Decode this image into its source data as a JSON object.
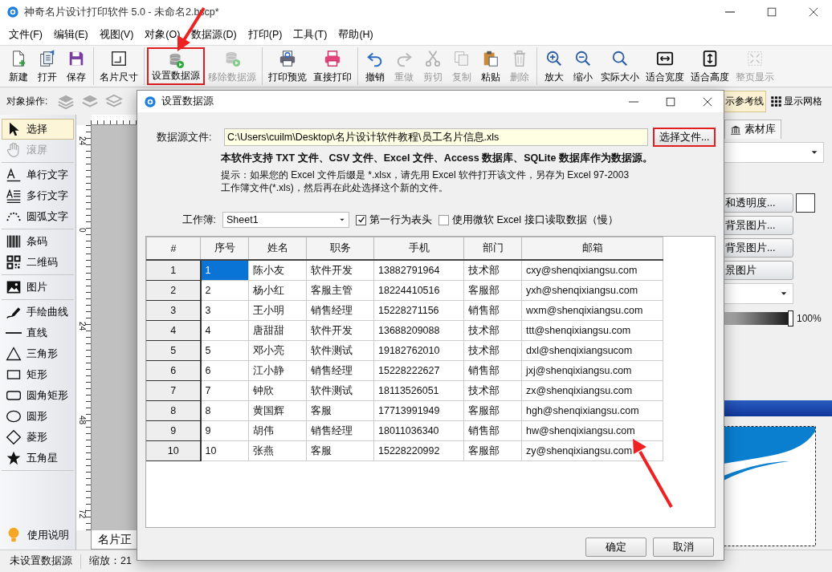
{
  "window": {
    "title": "神奇名片设计打印软件 5.0 - 未命名2.bscp*"
  },
  "menu": [
    "文件(F)",
    "编辑(E)",
    "视图(V)",
    "对象(O)",
    "数据源(D)",
    "打印(P)",
    "工具(T)",
    "帮助(H)"
  ],
  "toolbar": [
    {
      "items": [
        {
          "label": "新建",
          "disabled": false,
          "highlighted": false
        },
        {
          "label": "打开",
          "disabled": false,
          "highlighted": false
        },
        {
          "label": "保存",
          "disabled": false,
          "highlighted": false
        }
      ]
    },
    {
      "items": [
        {
          "label": "名片尺寸",
          "disabled": false,
          "highlighted": false
        }
      ]
    },
    {
      "items": [
        {
          "label": "设置数据源",
          "disabled": false,
          "highlighted": true
        },
        {
          "label": "移除数据源",
          "disabled": true,
          "highlighted": false
        }
      ]
    },
    {
      "items": [
        {
          "label": "打印预览",
          "disabled": false,
          "highlighted": false
        },
        {
          "label": "直接打印",
          "disabled": false,
          "highlighted": false
        }
      ]
    },
    {
      "items": [
        {
          "label": "撤销",
          "disabled": false,
          "highlighted": false
        },
        {
          "label": "重做",
          "disabled": true,
          "highlighted": false
        },
        {
          "label": "剪切",
          "disabled": true,
          "highlighted": false
        },
        {
          "label": "复制",
          "disabled": true,
          "highlighted": false
        },
        {
          "label": "粘贴",
          "disabled": false,
          "highlighted": false
        },
        {
          "label": "删除",
          "disabled": true,
          "highlighted": false
        }
      ]
    },
    {
      "items": [
        {
          "label": "放大",
          "disabled": false,
          "highlighted": false
        },
        {
          "label": "缩小",
          "disabled": false,
          "highlighted": false
        },
        {
          "label": "实际大小",
          "disabled": false,
          "highlighted": false
        },
        {
          "label": "适合宽度",
          "disabled": false,
          "highlighted": false
        },
        {
          "label": "适合高度",
          "disabled": false,
          "highlighted": false
        },
        {
          "label": "整页显示",
          "disabled": true,
          "highlighted": false
        }
      ]
    }
  ],
  "object_bar": {
    "label": "对象操作:",
    "guides": {
      "label": "示参考线",
      "selected": true
    },
    "grid": {
      "label": "显示网格",
      "selected": false
    }
  },
  "tools": [
    {
      "items": [
        {
          "label": "选择",
          "selected": true,
          "disabled": false
        },
        {
          "label": "滚屏",
          "selected": false,
          "disabled": true
        }
      ]
    },
    {
      "items": [
        {
          "label": "单行文字",
          "selected": false,
          "disabled": false
        },
        {
          "label": "多行文字",
          "selected": false,
          "disabled": false
        },
        {
          "label": "圆弧文字",
          "selected": false,
          "disabled": false
        }
      ]
    },
    {
      "items": [
        {
          "label": "条码",
          "selected": false,
          "disabled": false
        },
        {
          "label": "二维码",
          "selected": false,
          "disabled": false
        }
      ]
    },
    {
      "items": [
        {
          "label": "图片",
          "selected": false,
          "disabled": false
        }
      ]
    },
    {
      "items": [
        {
          "label": "手绘曲线",
          "selected": false,
          "disabled": false
        },
        {
          "label": "直线",
          "selected": false,
          "disabled": false
        },
        {
          "label": "三角形",
          "selected": false,
          "disabled": false
        },
        {
          "label": "矩形",
          "selected": false,
          "disabled": false
        },
        {
          "label": "圆角矩形",
          "selected": false,
          "disabled": false
        },
        {
          "label": "圆形",
          "selected": false,
          "disabled": false
        },
        {
          "label": "菱形",
          "selected": false,
          "disabled": false
        },
        {
          "label": "五角星",
          "selected": false,
          "disabled": false
        }
      ]
    }
  ],
  "help": {
    "label": "使用说明"
  },
  "ruler": {
    "labels": [
      "24",
      "0",
      "24",
      "48",
      "72"
    ]
  },
  "page_tab": {
    "label": "名片正"
  },
  "right_panel": {
    "tab": "素材库",
    "buttons": [
      "和透明度...",
      "背景图片...",
      "背景图片...",
      "景图片"
    ],
    "opacity": {
      "level": 1,
      "reading": "100%"
    }
  },
  "status_bar": {
    "datasource": "未设置数据源",
    "zoom": "缩放：21"
  },
  "dialog": {
    "title": "设置数据源",
    "file_label": "数据源文件:",
    "file_path": "C:\\Users\\cuilm\\Desktop\\名片设计软件教程\\员工名片信息.xls",
    "browse_button": {
      "label": "选择文件...",
      "highlighted": true
    },
    "support_note": "本软件支持 TXT 文件、CSV 文件、Excel 文件、Access 数据库、SQLite 数据库作为数据源。",
    "hint_lines": [
      "提示：如果您的 Excel 文件后缀是 *.xlsx，请先用 Excel 软件打开该文件，另存为 Excel 97-2003",
      "工作簿文件(*.xls)，然后再在此处选择这个新的文件。"
    ],
    "sheet_label": "工作簿:",
    "sheet_value": "Sheet1",
    "options": [
      {
        "label": "第一行为表头",
        "checked": true
      },
      {
        "label": "使用微软 Excel 接口读取数据（慢）",
        "checked": false
      }
    ],
    "table": {
      "columns": [
        "#",
        "序号",
        "姓名",
        "职务",
        "手机",
        "部门",
        "邮箱"
      ],
      "rows": [
        {
          "cells": [
            "1",
            "1",
            "陈小友",
            "软件开发",
            "13882791964",
            "技术部",
            "cxy@shenqixiangsu.com"
          ],
          "selected": true
        },
        {
          "cells": [
            "2",
            "2",
            "杨小红",
            "客服主管",
            "18224410516",
            "客服部",
            "yxh@shenqixiangsu.com"
          ],
          "selected": false
        },
        {
          "cells": [
            "3",
            "3",
            "王小明",
            "销售经理",
            "15228271156",
            "销售部",
            "wxm@shenqixiangsu.com"
          ],
          "selected": false
        },
        {
          "cells": [
            "4",
            "4",
            "唐甜甜",
            "软件开发",
            "13688209088",
            "技术部",
            "ttt@shenqixiangsu.com"
          ],
          "selected": false
        },
        {
          "cells": [
            "5",
            "5",
            "邓小亮",
            "软件测试",
            "19182762010",
            "技术部",
            "dxl@shenqixiangsucom"
          ],
          "selected": false
        },
        {
          "cells": [
            "6",
            "6",
            "江小静",
            "销售经理",
            "15228222627",
            "销售部",
            "jxj@shenqixiangsu.com"
          ],
          "selected": false
        },
        {
          "cells": [
            "7",
            "7",
            "钟欣",
            "软件测试",
            "18113526051",
            "技术部",
            "zx@shenqixiangsu.com"
          ],
          "selected": false
        },
        {
          "cells": [
            "8",
            "8",
            "黄国辉",
            "客服",
            "17713991949",
            "客服部",
            "hgh@shenqixiangsu.com"
          ],
          "selected": false
        },
        {
          "cells": [
            "9",
            "9",
            "胡伟",
            "销售经理",
            "18011036340",
            "销售部",
            "hw@shenqixiangsu.com"
          ],
          "selected": false
        },
        {
          "cells": [
            "10",
            "10",
            "张燕",
            "客服",
            "15228220992",
            "客服部",
            "zy@shenqixiangsu.com"
          ],
          "selected": false
        }
      ]
    },
    "buttons": [
      "确定",
      "取消"
    ]
  }
}
